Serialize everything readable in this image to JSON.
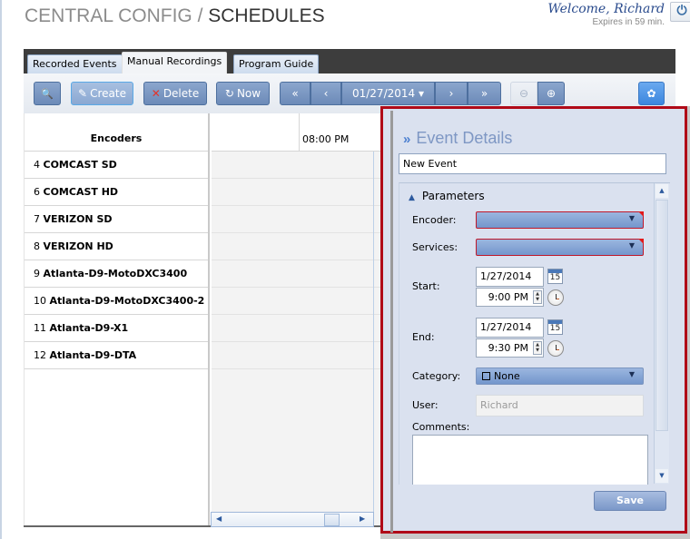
{
  "header": {
    "title_prefix": "CENTRAL CONFIG / ",
    "title_current": "SCHEDULES",
    "welcome": "Welcome, Richard",
    "expires": "Expires in 59 min.",
    "power_icon": "⏻"
  },
  "tabs": [
    {
      "label": "Recorded Events",
      "active": false
    },
    {
      "label": "Manual Recordings",
      "active": true
    },
    {
      "label": "Program Guide",
      "active": false
    }
  ],
  "toolbar": {
    "search_icon": "🔍",
    "create_icon": "✎",
    "create_label": "Create",
    "delete_icon": "✕",
    "delete_label": "Delete",
    "now_icon": "↻",
    "now_label": "Now",
    "first_label": "«",
    "prev_label": "‹",
    "date_label": "01/27/2014 ▾",
    "next_label": "›",
    "last_label": "»",
    "zoom_out_icon": "⊖",
    "zoom_in_icon": "⊕",
    "settings_icon": "✿"
  },
  "grid": {
    "encoders_header": "Encoders",
    "time_header": "08:00 PM",
    "rows": [
      {
        "num": "4",
        "name": "COMCAST SD"
      },
      {
        "num": "6",
        "name": "COMCAST HD"
      },
      {
        "num": "7",
        "name": "VERIZON SD"
      },
      {
        "num": "8",
        "name": "VERIZON HD"
      },
      {
        "num": "9",
        "name": "Atlanta-D9-MotoDXC3400"
      },
      {
        "num": "10",
        "name": "Atlanta-D9-MotoDXC3400-2"
      },
      {
        "num": "11",
        "name": "Atlanta-D9-X1"
      },
      {
        "num": "12",
        "name": "Atlanta-D9-DTA"
      }
    ]
  },
  "panel": {
    "chevron": "»",
    "title": "Event Details",
    "event_name": "New Event",
    "parameters_label": "Parameters",
    "encoder_label": "Encoder:",
    "encoder_value": "",
    "services_label": "Services:",
    "services_value": "",
    "start_label": "Start:",
    "start_date": "1/27/2014",
    "start_time": "9:00 PM",
    "end_label": "End:",
    "end_date": "1/27/2014",
    "end_time": "9:30 PM",
    "calendar_day": "15",
    "category_label": "Category:",
    "category_value": "None",
    "user_label": "User:",
    "user_value": "Richard",
    "comments_label": "Comments:",
    "comments_value": "",
    "save_label": "Save"
  },
  "colors": {
    "highlight_border": "#b00a18",
    "accent": "#3b86de",
    "required_marker": "#e31a1a"
  }
}
